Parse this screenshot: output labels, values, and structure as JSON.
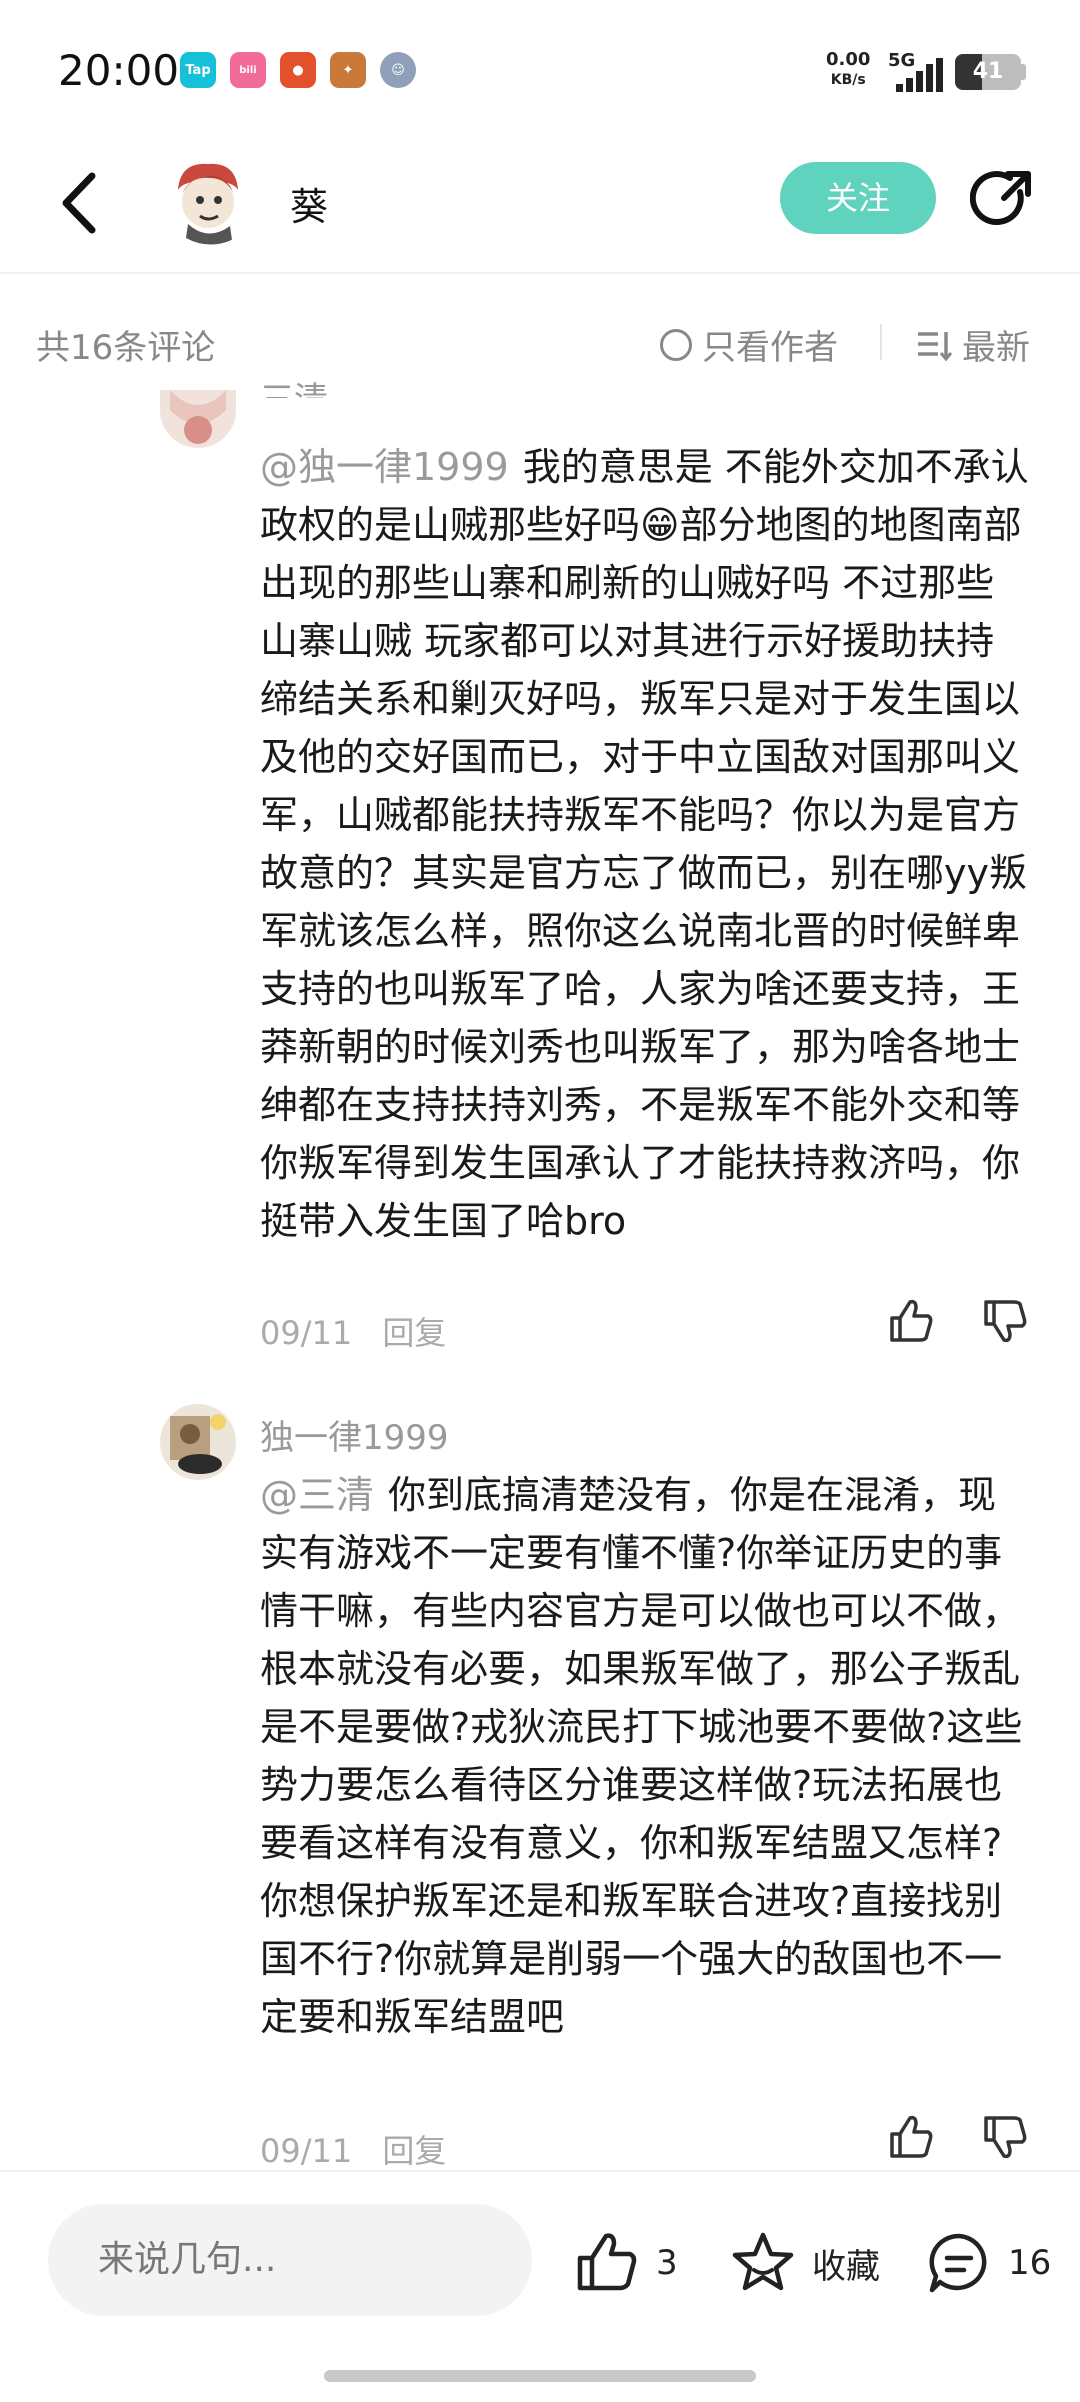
{
  "status_bar": {
    "time": "20:00",
    "net_speed_value": "0.00",
    "net_speed_unit": "KB/s",
    "network": "5G",
    "battery": "41",
    "battery_level": 0.41,
    "app_icons": [
      {
        "label": "Tap",
        "color": "#16c0d8"
      },
      {
        "label": "bilibili",
        "color": "#f16c9a"
      },
      {
        "label": "",
        "color": "#e2502c"
      },
      {
        "label": "",
        "color": "#c97a3a"
      },
      {
        "label": "",
        "color": "#8fa0b8"
      }
    ]
  },
  "header": {
    "author_name": "葵",
    "follow_label": "关注"
  },
  "comment_bar": {
    "count_label": "共16条评论",
    "only_author_label": "只看作者",
    "sort_label": "最新"
  },
  "comments": [
    {
      "user": "三清",
      "mention": "@独一律1999",
      "text": "我的意思是 不能外交加不承认政权的是山贼那些好吗😁部分地图的地图南部出现的那些山寨和刷新的山贼好吗 不过那些山寨山贼 玩家都可以对其进行示好援助扶持缔结关系和剿灭好吗，叛军只是对于发生国以及他的交好国而已，对于中立国敌对国那叫义军，山贼都能扶持叛军不能吗？你以为是官方故意的？其实是官方忘了做而已，别在哪yy叛军就该怎么样，照你这么说南北晋的时候鲜卑支持的也叫叛军了哈，人家为啥还要支持，王莽新朝的时候刘秀也叫叛军了，那为啥各地士绅都在支持扶持刘秀，不是叛军不能外交和等你叛军得到发生国承认了才能扶持救济吗，你挺带入发生国了哈bro",
      "date": "09/11",
      "reply_label": "回复"
    },
    {
      "user": "独一律1999",
      "mention": "@三清",
      "text": "你到底搞清楚没有，你是在混淆，现实有游戏不一定要有懂不懂?你举证历史的事情干嘛，有些内容官方是可以做也可以不做，根本就没有必要，如果叛军做了，那公子叛乱是不是要做?戎狄流民打下城池要不要做?这些势力要怎么看待区分谁要这样做?玩法拓展也要看这样有没有意义，你和叛军结盟又怎样?你想保护叛军还是和叛军联合进攻?直接找别国不行?你就算是削弱一个强大的敌国也不一定要和叛军结盟吧",
      "date": "09/11",
      "reply_label": "回复"
    }
  ],
  "bottom_bar": {
    "input_placeholder": "来说几句...",
    "like_count": "3",
    "favorite_label": "收藏",
    "comment_count": "16"
  }
}
